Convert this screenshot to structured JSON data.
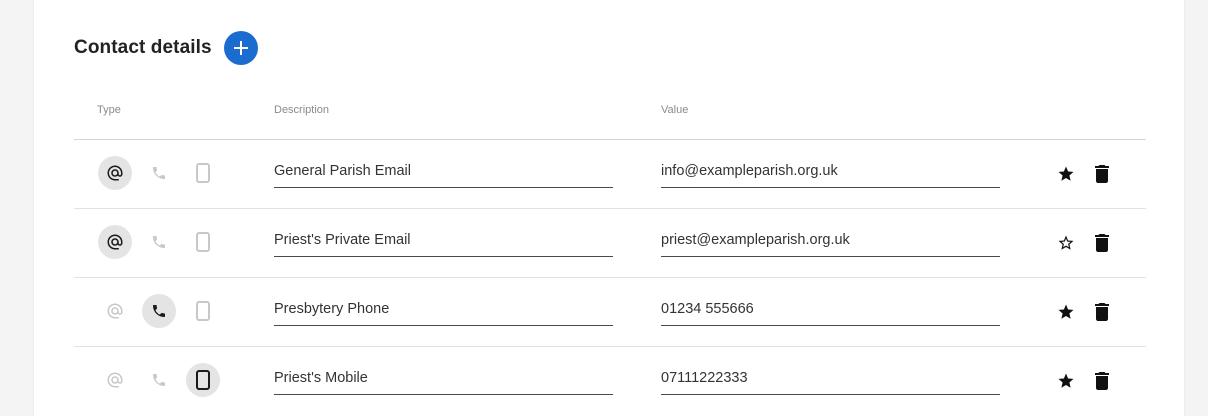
{
  "header": {
    "title": "Contact details"
  },
  "columns": {
    "type": "Type",
    "description": "Description",
    "value": "Value"
  },
  "colors": {
    "accent": "#1b6cd0",
    "active_type_bg": "#e4e4e4",
    "inactive_icon": "#c8c8c8",
    "active_icon": "#1a1a1a"
  },
  "rows": [
    {
      "type": "email",
      "description": "General Parish Email",
      "value": "info@exampleparish.org.uk",
      "starred": true
    },
    {
      "type": "email",
      "description": "Priest's Private Email",
      "value": "priest@exampleparish.org.uk",
      "starred": false
    },
    {
      "type": "phone",
      "description": "Presbytery Phone",
      "value": "01234 555666",
      "starred": true
    },
    {
      "type": "mobile",
      "description": "Priest's Mobile",
      "value": "07111222333",
      "starred": true
    }
  ],
  "icons": {
    "add": "plus-icon",
    "email": "at-icon",
    "phone": "phone-icon",
    "mobile": "mobile-phone-icon",
    "star_filled": "star-filled-icon",
    "star_outline": "star-outline-icon",
    "delete": "trash-icon"
  }
}
